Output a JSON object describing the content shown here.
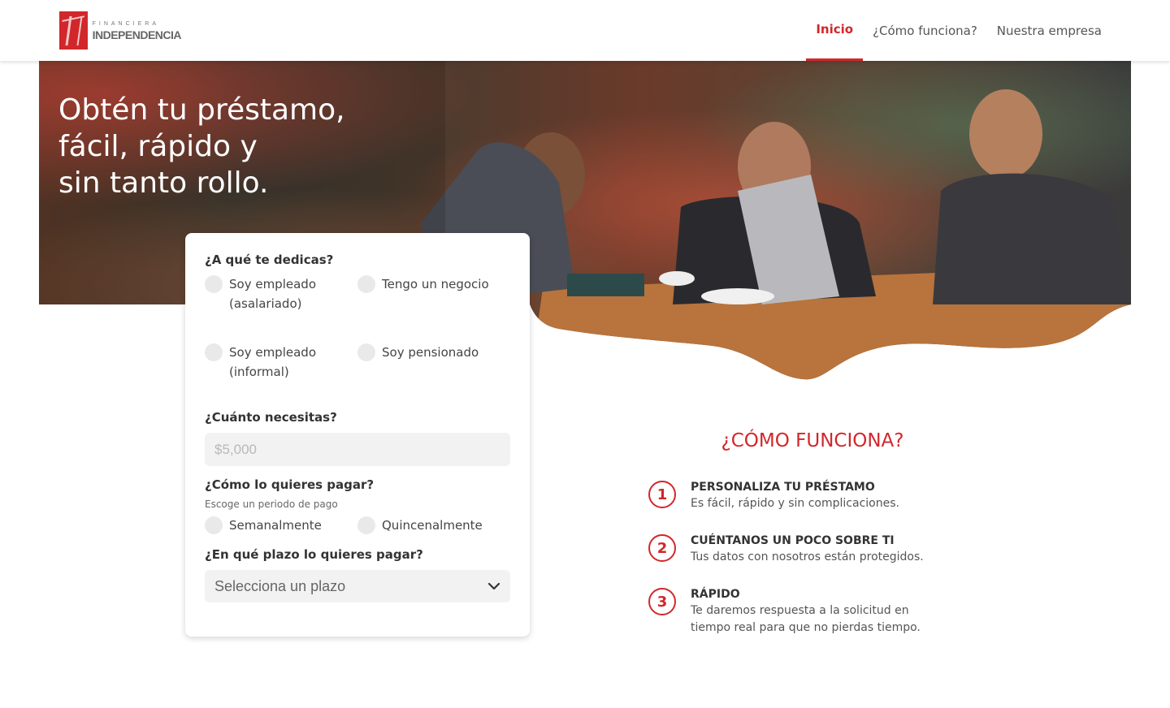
{
  "brand": {
    "top": "FINANCIERA",
    "name": "INDEPENDENCIA"
  },
  "nav": [
    {
      "label": "Inicio",
      "active": true
    },
    {
      "label": "¿Cómo funciona?",
      "active": false
    },
    {
      "label": "Nuestra empresa",
      "active": false
    }
  ],
  "hero": {
    "title_lines": [
      "Obtén tu préstamo,",
      "fácil, rápido y",
      "sin tanto rollo."
    ]
  },
  "form": {
    "occupation_question": "¿A qué te dedicas?",
    "occupation_options": [
      "Soy empleado (asalariado)",
      "Tengo un negocio",
      "Soy empleado (informal)",
      "Soy pensionado"
    ],
    "amount_question": "¿Cuánto necesitas?",
    "amount_placeholder": "$5,000",
    "payment_question": "¿Cómo lo quieres pagar?",
    "payment_hint": "Escoge un periodo de pago",
    "payment_options": [
      "Semanalmente",
      "Quincenalmente"
    ],
    "term_question": "¿En qué plazo lo quieres pagar?",
    "term_value": "Selecciona un plazo"
  },
  "how": {
    "title": "¿CÓMO FUNCIONA?",
    "steps": [
      {
        "num": "1",
        "title": "PERSONALIZA TU PRÉSTAMO",
        "desc": "Es fácil, rápido y sin complicaciones."
      },
      {
        "num": "2",
        "title": "CUÉNTANOS UN POCO SOBRE TI",
        "desc": "Tus datos con nosotros están protegidos."
      },
      {
        "num": "3",
        "title": "RÁPIDO",
        "desc": "Te daremos respuesta a la solicitud en tiempo real para que no pierdas tiempo."
      }
    ]
  },
  "colors": {
    "accent": "#d1272b",
    "field_bg": "#f2f2f2",
    "radio_bg": "#e9e9e9"
  }
}
